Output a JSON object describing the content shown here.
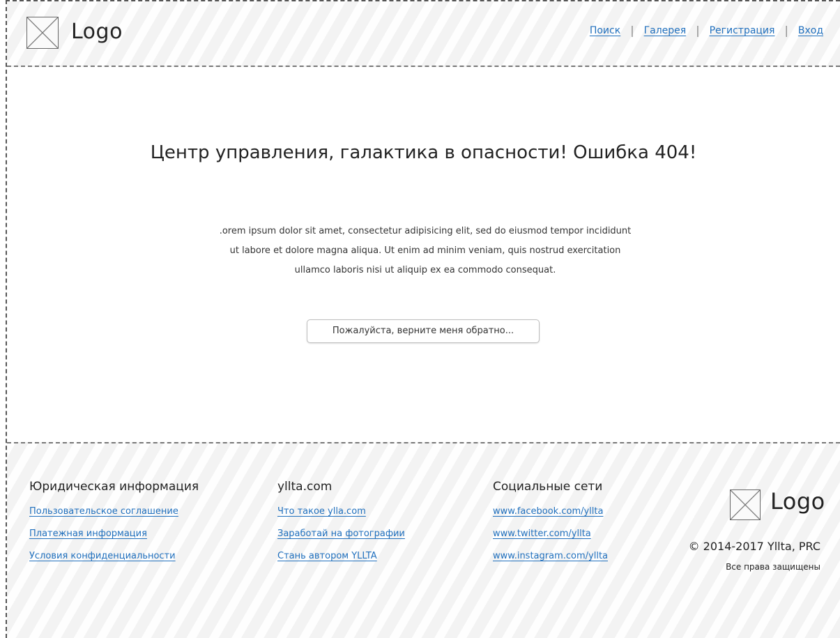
{
  "header": {
    "logo_text": "Logo",
    "nav": [
      "Поиск",
      "Галерея",
      "Регистрация",
      "Вход"
    ]
  },
  "main": {
    "title": "Центр управления, галактика в опасности! Ошибка 404!",
    "lead": ".orem ipsum dolor sit amet, consectetur adipisicing elit, sed do eiusmod tempor incididunt ut labore et dolore magna aliqua. Ut enim ad minim veniam, quis nostrud exercitation ullamco laboris nisi ut aliquip ex ea commodo consequat.",
    "back_button": "Пожалуйста, верните меня обратно..."
  },
  "footer": {
    "columns": [
      {
        "title": "Юридическая информация",
        "links": [
          "Пользовательское соглашение",
          "Платежная информация",
          "Условия конфиденциальности"
        ]
      },
      {
        "title": "yllta.com",
        "links": [
          "Что такое ylla.com",
          "Заработай на фотографии",
          "Стань автором YLLTA"
        ]
      },
      {
        "title": "Социальные сети",
        "links": [
          "www.facebook.com/yllta",
          "www.twitter.com/yllta",
          "www.instagram.com/yllta"
        ]
      }
    ],
    "logo_text": "Logo",
    "copyright": "© 2014-2017 Yllta, PRC",
    "rights": "Все права защищены"
  },
  "colors": {
    "link": "#1f6fbd",
    "text": "#2b2b2b",
    "stripe_bg": "#f3f3f3"
  }
}
